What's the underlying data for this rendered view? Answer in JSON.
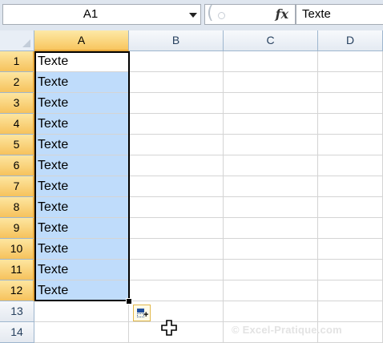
{
  "formula_bar": {
    "name_box": "A1",
    "fx_icon": "fx-icon",
    "formula_value": "Texte"
  },
  "columns": [
    "A",
    "B",
    "C",
    "D"
  ],
  "rows": [
    {
      "label": "1",
      "A": "Texte"
    },
    {
      "label": "2",
      "A": "Texte"
    },
    {
      "label": "3",
      "A": "Texte"
    },
    {
      "label": "4",
      "A": "Texte"
    },
    {
      "label": "5",
      "A": "Texte"
    },
    {
      "label": "6",
      "A": "Texte"
    },
    {
      "label": "7",
      "A": "Texte"
    },
    {
      "label": "8",
      "A": "Texte"
    },
    {
      "label": "9",
      "A": "Texte"
    },
    {
      "label": "10",
      "A": "Texte"
    },
    {
      "label": "11",
      "A": "Texte"
    },
    {
      "label": "12",
      "A": "Texte"
    },
    {
      "label": "13",
      "A": ""
    },
    {
      "label": "14",
      "A": ""
    }
  ],
  "selection": {
    "range": "A1:A12",
    "active_cell": "A1"
  },
  "icons": {
    "autofill_options": "autofill-options-icon",
    "cursor": "crosshair-cursor-icon"
  },
  "watermark": "© Excel-Pratique.com",
  "colors": {
    "selection_fill": "#bfdcfb",
    "header_selected": "#f8c65f",
    "gridline": "#d4d4d4"
  }
}
